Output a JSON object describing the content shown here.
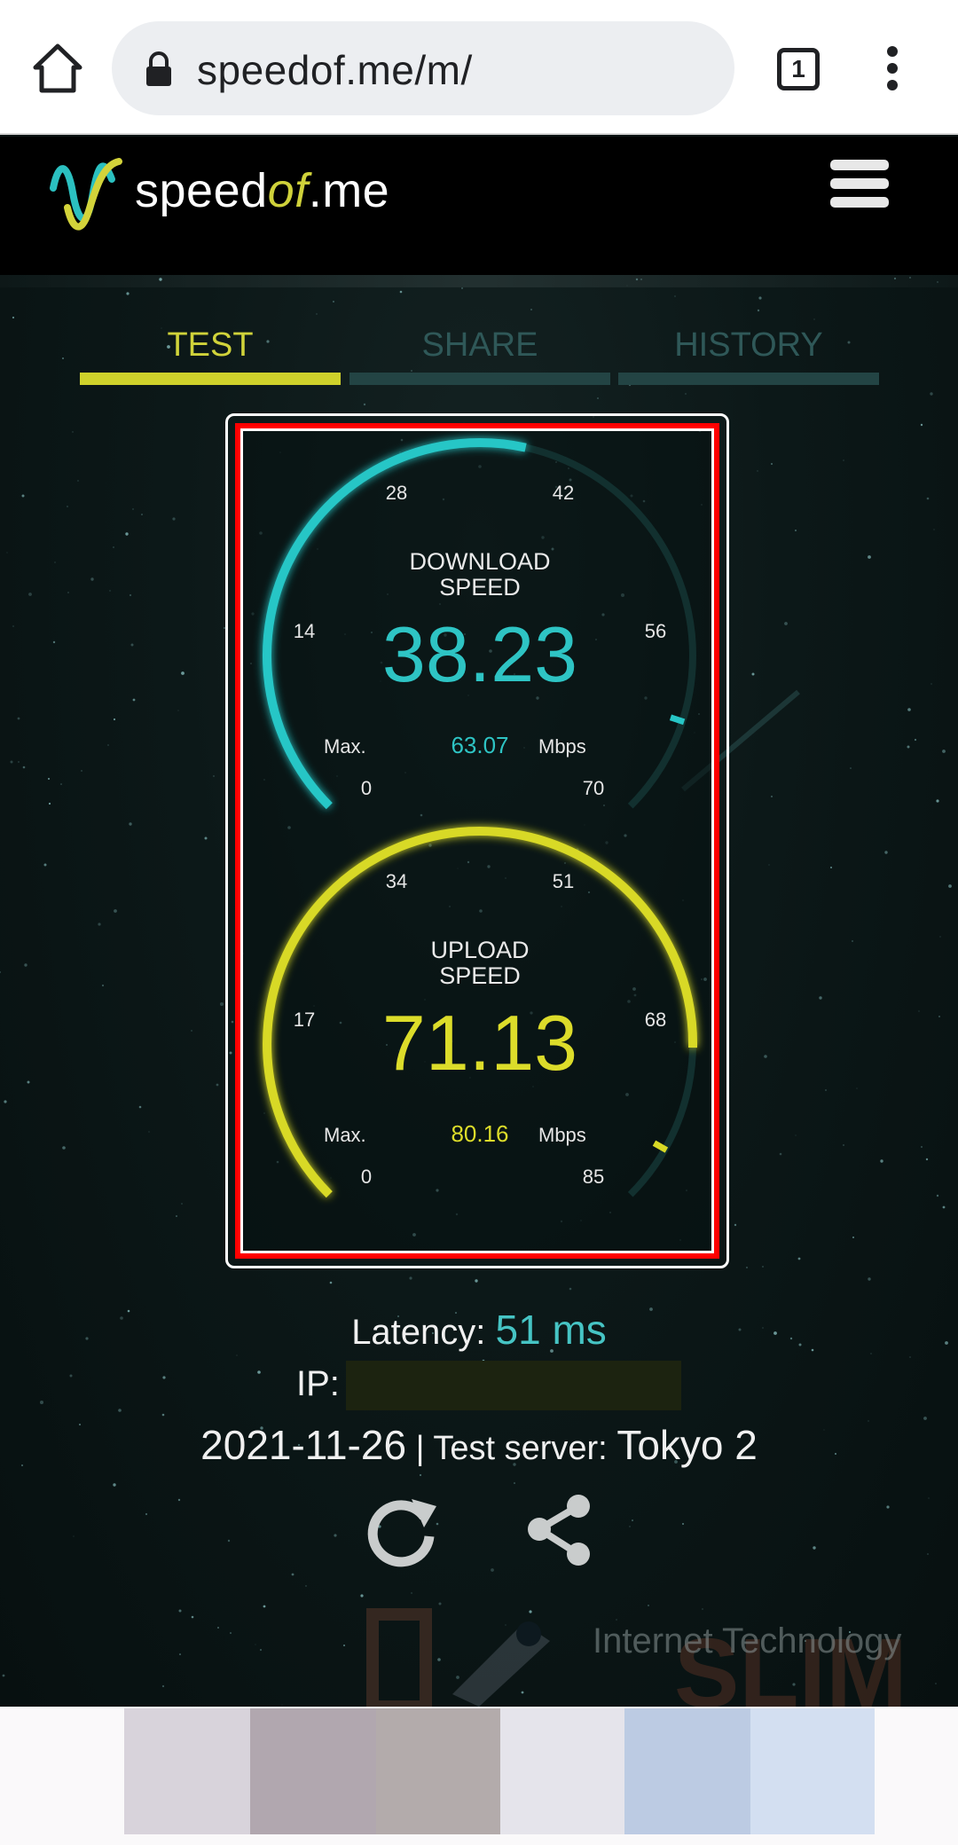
{
  "browser": {
    "url": "speedof.me/m/",
    "tab_count": "1"
  },
  "site": {
    "logo_prefix": "speed",
    "logo_of": "of",
    "logo_suffix": ".me"
  },
  "tabs": [
    {
      "label": "TEST",
      "active": true
    },
    {
      "label": "SHARE",
      "active": false
    },
    {
      "label": "HISTORY",
      "active": false
    }
  ],
  "download": {
    "title_line1": "DOWNLOAD",
    "title_line2": "SPEED",
    "value": "38.23",
    "max_label": "Max.",
    "max_value": "63.07",
    "unit": "Mbps",
    "ticks": [
      "0",
      "14",
      "28",
      "42",
      "56",
      "70"
    ],
    "fraction": 0.546,
    "max_fraction": 0.9,
    "color": "#27c6c6"
  },
  "upload": {
    "title_line1": "UPLOAD",
    "title_line2": "SPEED",
    "value": "71.13",
    "max_label": "Max.",
    "max_value": "80.16",
    "unit": "Mbps",
    "ticks": [
      "0",
      "17",
      "34",
      "51",
      "68",
      "85"
    ],
    "fraction": 0.837,
    "max_fraction": 0.943,
    "color": "#d8d925"
  },
  "info": {
    "latency_label": "Latency:",
    "latency_value": "51 ms",
    "ip_label": "IP:",
    "date": "2021-11-26",
    "separator": "|",
    "server_label": "Test server:",
    "server_value": "Tokyo 2"
  },
  "watermark": {
    "text": "Internet Technology"
  },
  "icons": {
    "home": "home-icon",
    "lock": "lock-icon",
    "tabs": "tab-switcher-icon",
    "more": "more-vert-icon",
    "menu": "hamburger-icon",
    "retest": "refresh-icon",
    "share": "share-icon"
  },
  "swatches": [
    "#d8d3db",
    "#b1a7af",
    "#b3abab",
    "#e5e4eb",
    "#bccbe3",
    "#d3dff1"
  ]
}
